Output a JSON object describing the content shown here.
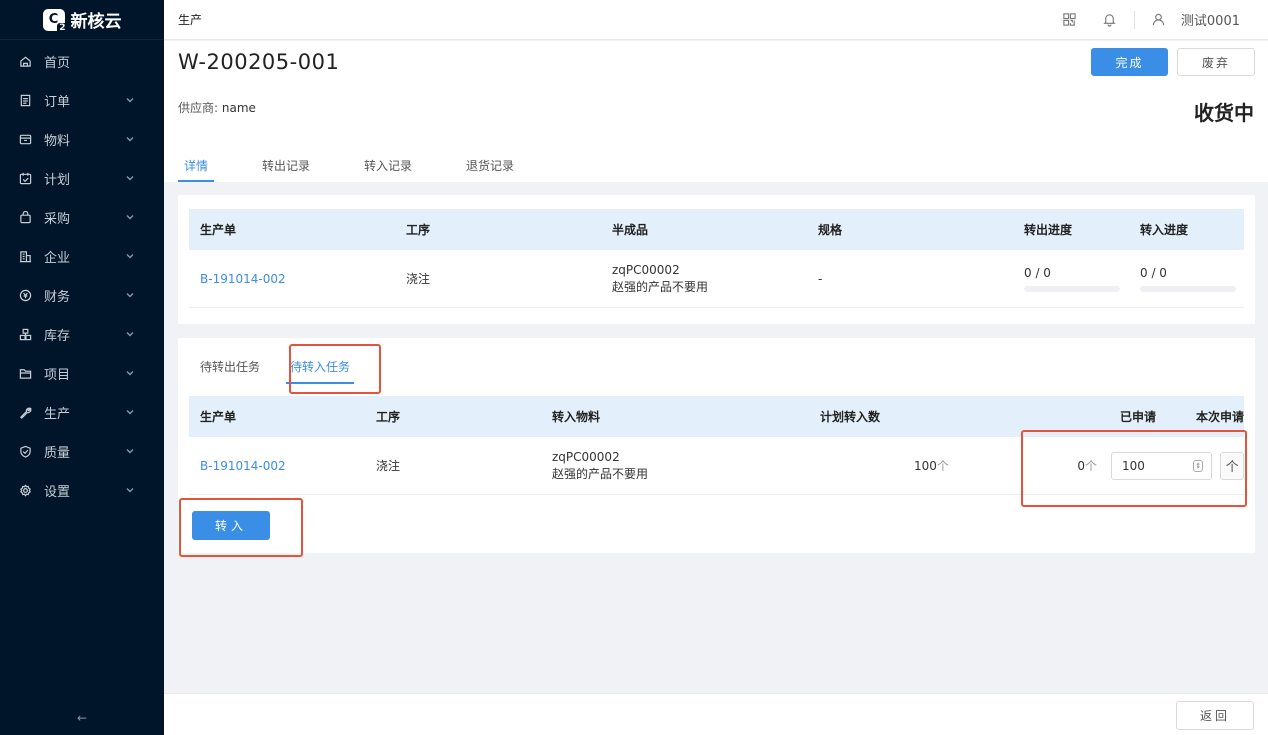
{
  "app": {
    "logo_text": "新核云"
  },
  "sidebar": {
    "items": [
      {
        "label": "首页",
        "icon": "home-icon",
        "expandable": false
      },
      {
        "label": "订单",
        "icon": "order-icon",
        "expandable": true
      },
      {
        "label": "物料",
        "icon": "material-icon",
        "expandable": true
      },
      {
        "label": "计划",
        "icon": "plan-icon",
        "expandable": true
      },
      {
        "label": "采购",
        "icon": "purchase-icon",
        "expandable": true
      },
      {
        "label": "企业",
        "icon": "enterprise-icon",
        "expandable": true
      },
      {
        "label": "财务",
        "icon": "finance-icon",
        "expandable": true
      },
      {
        "label": "库存",
        "icon": "inventory-icon",
        "expandable": true
      },
      {
        "label": "项目",
        "icon": "project-icon",
        "expandable": true
      },
      {
        "label": "生产",
        "icon": "production-icon",
        "expandable": true
      },
      {
        "label": "质量",
        "icon": "quality-icon",
        "expandable": true
      },
      {
        "label": "设置",
        "icon": "settings-icon",
        "expandable": true
      }
    ],
    "collapse_label": "←"
  },
  "header": {
    "title": "生产",
    "user_name": "测试0001"
  },
  "page": {
    "doc_number": "W-200205-001",
    "complete_label": "完成",
    "discard_label": "废弃",
    "supplier_label": "供应商:",
    "supplier_value": "name",
    "status": "收货中",
    "tabs": [
      "详情",
      "转出记录",
      "转入记录",
      "退货记录"
    ]
  },
  "detail_table": {
    "headers": [
      "生产单",
      "工序",
      "半成品",
      "规格",
      "转出进度",
      "转入进度"
    ],
    "rows": [
      {
        "order": "B-191014-002",
        "process": "浇注",
        "product_code": "zqPC00002",
        "product_name": "赵强的产品不要用",
        "spec": "-",
        "out_progress": "0 / 0",
        "out_fraction": 0,
        "in_progress": "0 / 0",
        "in_fraction": 0
      }
    ]
  },
  "task_section": {
    "tabs": [
      "待转出任务",
      "待转入任务"
    ],
    "active_tab": 1,
    "headers": [
      "生产单",
      "工序",
      "转入物料",
      "计划转入数",
      "已申请",
      "本次申请"
    ],
    "rows": [
      {
        "order": "B-191014-002",
        "process": "浇注",
        "material_code": "zqPC00002",
        "material_name": "赵强的产品不要用",
        "planned_qty": "100",
        "planned_unit": "个",
        "applied_qty": "0",
        "applied_unit": "个",
        "current_value": "100",
        "current_unit": "个"
      }
    ],
    "transfer_label": "转入"
  },
  "footer": {
    "back_label": "返回"
  },
  "colors": {
    "accent": "#3a8ee6",
    "sidebar_bg": "#001529",
    "highlight": "#e5533c",
    "table_header_bg": "#e3f0fb"
  }
}
